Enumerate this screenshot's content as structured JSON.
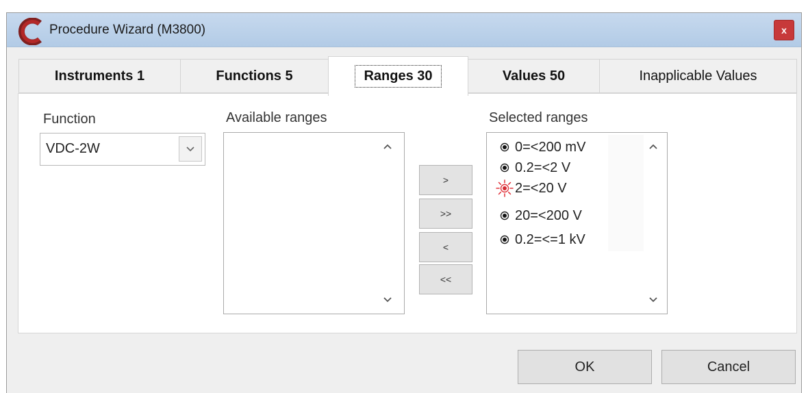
{
  "window": {
    "title": "Procedure Wizard (M3800)",
    "close_glyph": "x",
    "logo_icon": "c-logo-icon",
    "accent_color": "#c7393a"
  },
  "tabs": [
    {
      "label": "Instruments 1",
      "active": false
    },
    {
      "label": "Functions 5",
      "active": false
    },
    {
      "label": "Ranges 30",
      "active": true
    },
    {
      "label": "Values 50",
      "active": false
    },
    {
      "label": "Inapplicable Values",
      "active": false
    }
  ],
  "function": {
    "label": "Function",
    "value": "VDC-2W"
  },
  "available": {
    "label": "Available ranges",
    "items": []
  },
  "move_buttons": [
    {
      "label": ">"
    },
    {
      "label": ">>"
    },
    {
      "label": "<"
    },
    {
      "label": "<<"
    }
  ],
  "selected": {
    "label": "Selected ranges",
    "items": [
      {
        "text": "0=<200 mV",
        "icon": "radio-dot-icon"
      },
      {
        "text": "0.2=<2 V",
        "icon": "radio-dot-icon"
      },
      {
        "text": "2=<20 V",
        "icon": "highlighted-target-icon"
      },
      {
        "text": "20=<200 V",
        "icon": "radio-dot-icon"
      },
      {
        "text": "0.2=<=1 kV",
        "icon": "radio-dot-icon"
      }
    ]
  },
  "buttons": {
    "ok": "OK",
    "cancel": "Cancel"
  }
}
